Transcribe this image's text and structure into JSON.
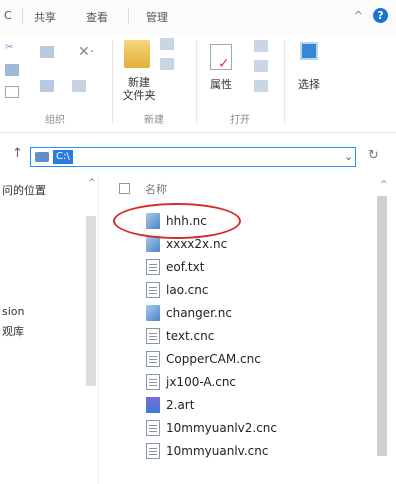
{
  "tabs": {
    "file_partial": "C",
    "share": "共享",
    "view": "查看",
    "manage": "管理"
  },
  "ribbon": {
    "groups": [
      {
        "label": "组织"
      },
      {
        "label": "新建"
      },
      {
        "label": "打开"
      }
    ],
    "new_folder_label": "新建\n文件夹",
    "properties_label": "属性",
    "select_label": "选择"
  },
  "address": {
    "path": "C:\\"
  },
  "nav": {
    "items": [
      {
        "label": "问的位置"
      },
      {
        "label": "sion"
      },
      {
        "label": "观库"
      }
    ]
  },
  "list": {
    "column_name": "名称",
    "files": [
      {
        "name": "hhh.nc",
        "icon": "nc-file-icon"
      },
      {
        "name": "xxxx2x.nc",
        "icon": "nc-file-icon"
      },
      {
        "name": "eof.txt",
        "icon": "text-file-icon"
      },
      {
        "name": "lao.cnc",
        "icon": "text-file-icon"
      },
      {
        "name": "changer.nc",
        "icon": "nc-file-icon"
      },
      {
        "name": "text.cnc",
        "icon": "text-file-icon"
      },
      {
        "name": "CopperCAM.cnc",
        "icon": "text-file-icon"
      },
      {
        "name": "jx100-A.cnc",
        "icon": "text-file-icon"
      },
      {
        "name": "2.art",
        "icon": "art-file-icon"
      },
      {
        "name": "10mmyuanlv2.cnc",
        "icon": "text-file-icon"
      },
      {
        "name": "10mmyuanlv.cnc",
        "icon": "text-file-icon"
      }
    ]
  },
  "colors": {
    "accent": "#1e90ff",
    "selection": "#2a7dde",
    "highlight_oval": "#d42c2c",
    "help": "#1b73d6"
  }
}
